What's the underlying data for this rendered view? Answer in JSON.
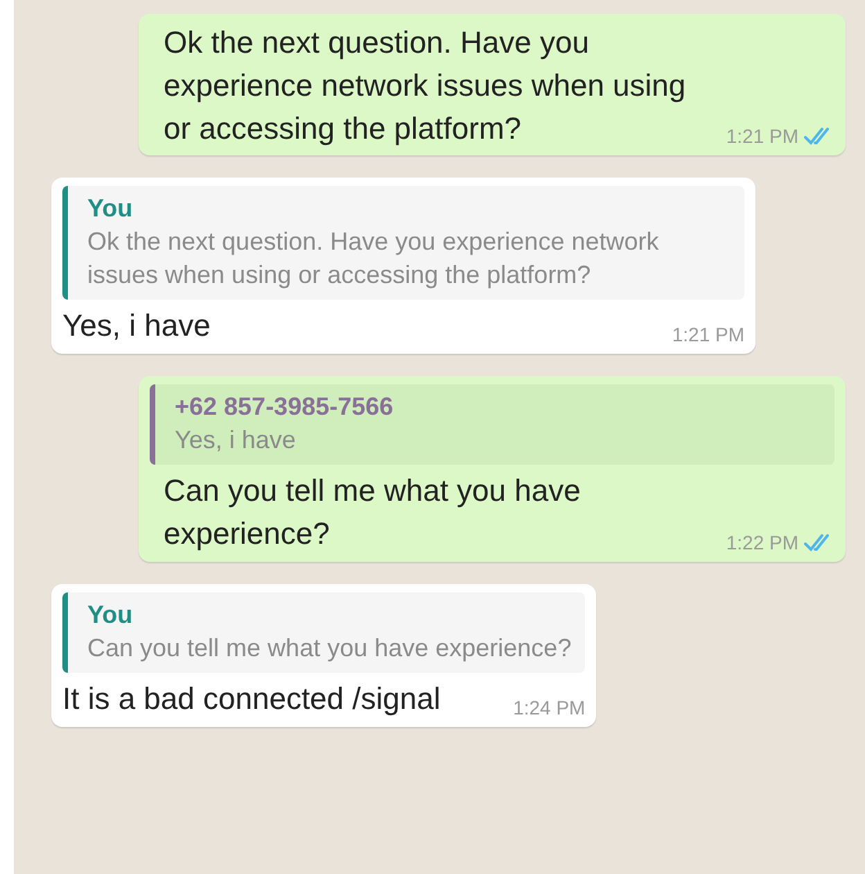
{
  "messages": [
    {
      "kind": "outgoing",
      "text": "Ok the next question. Have you experience network issues when using or accessing the platform?",
      "time": "1:21 PM",
      "read": true
    },
    {
      "kind": "incoming",
      "quote": {
        "author": "You",
        "color": "#1f8f86",
        "text": "Ok the next question. Have you experience network issues when using or accessing the platform?"
      },
      "text": "Yes, i have",
      "time": "1:21 PM"
    },
    {
      "kind": "outgoing",
      "quote": {
        "author": "+62 857-3985-7566",
        "color": "#8a6f99",
        "text": "Yes, i have"
      },
      "text": "Can you tell me what you have experience?",
      "time": "1:22 PM",
      "read": true
    },
    {
      "kind": "incoming",
      "quote": {
        "author": "You",
        "color": "#1f8f86",
        "text": "Can you tell me what you have experience?"
      },
      "text": "It is a bad connected /signal",
      "time": "1:24 PM"
    }
  ]
}
